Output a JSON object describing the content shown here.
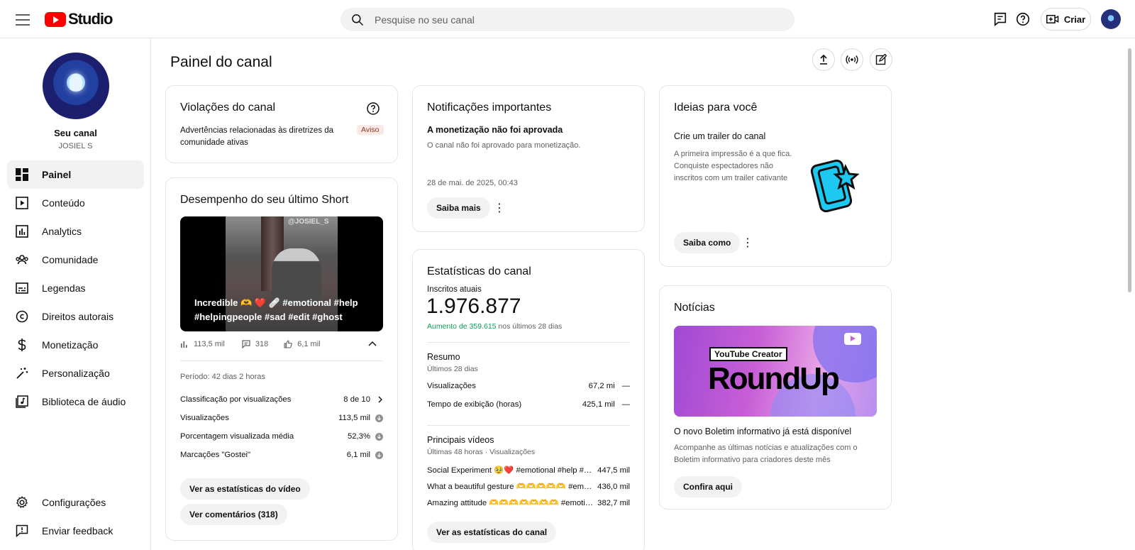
{
  "app": {
    "logo_text": "Studio"
  },
  "search": {
    "placeholder": "Pesquise no seu canal"
  },
  "topbar": {
    "create_label": "Criar"
  },
  "sidebar": {
    "channel_name": "Seu canal",
    "channel_handle": "JOSIEL S",
    "items": [
      {
        "label": "Painel",
        "icon": "dashboard-icon",
        "active": true
      },
      {
        "label": "Conteúdo",
        "icon": "content-icon"
      },
      {
        "label": "Analytics",
        "icon": "analytics-icon"
      },
      {
        "label": "Comunidade",
        "icon": "community-icon"
      },
      {
        "label": "Legendas",
        "icon": "subtitles-icon"
      },
      {
        "label": "Direitos autorais",
        "icon": "copyright-icon"
      },
      {
        "label": "Monetização",
        "icon": "monetization-icon"
      },
      {
        "label": "Personalização",
        "icon": "customization-icon"
      },
      {
        "label": "Biblioteca de áudio",
        "icon": "audio-library-icon"
      }
    ],
    "bottom_items": [
      {
        "label": "Configurações",
        "icon": "settings-icon"
      },
      {
        "label": "Enviar feedback",
        "icon": "feedback-icon"
      }
    ]
  },
  "page": {
    "title": "Painel do canal"
  },
  "violations": {
    "title": "Violações do canal",
    "text": "Advertências relacionadas às diretrizes da comunidade ativas",
    "badge": "Aviso"
  },
  "short": {
    "title": "Desempenho do seu último Short",
    "caption": "Incredible 🫶 ❤️ 🩹 #emotional #help #helpingpeople #sad #edit #ghost",
    "watermark": "@JOSIEL_S",
    "views": "113,5 mil",
    "comments": "318",
    "likes": "6,1 mil",
    "period": "Período: 42 dias 2 horas",
    "rows": [
      {
        "label": "Classificação por visualizações",
        "value": "8 de 10"
      },
      {
        "label": "Visualizações",
        "value": "113,5 mil"
      },
      {
        "label": "Porcentagem visualizada média",
        "value": "52,3%"
      },
      {
        "label": "Marcações \"Gostei\"",
        "value": "6,1 mil"
      }
    ],
    "btn_stats": "Ver as estatísticas do vídeo",
    "btn_comments": "Ver comentários (318)"
  },
  "notifications": {
    "title": "Notificações importantes",
    "subtitle": "A monetização não foi aprovada",
    "text": "O canal não foi aprovado para monetização.",
    "date": "28 de mai. de 2025, 00:43",
    "btn": "Saiba mais"
  },
  "stats": {
    "title": "Estatísticas do canal",
    "subs_label": "Inscritos atuais",
    "subs_value": "1.976.877",
    "growth_value": "Aumento de 359.615",
    "growth_suffix": "nos últimos 28 dias",
    "summary_title": "Resumo",
    "summary_sub": "Últimos 28 dias",
    "summary_rows": [
      {
        "label": "Visualizações",
        "value": "67,2 mi",
        "trend": "—"
      },
      {
        "label": "Tempo de exibição (horas)",
        "value": "425,1 mil",
        "trend": "—"
      }
    ],
    "top_title": "Principais vídeos",
    "top_sub": "Últimas 48 horas · Visualizações",
    "top_videos": [
      {
        "label": "Social Experiment 🥹❤️ #emotional #help #helpingpeople",
        "value": "447,5 mil"
      },
      {
        "label": "What a beautiful gesture 🫶🫶🫶🫶🫶 #emotional #help #helpingpeople",
        "value": "436,0 mil"
      },
      {
        "label": "Amazing attitude 🫶🫶🫶🫶🫶🫶🫶 #emotional #help #helpingpeople",
        "value": "382,7 mil"
      }
    ],
    "btn": "Ver as estatísticas do canal"
  },
  "ideas": {
    "title": "Ideias para você",
    "subtitle": "Crie um trailer do canal",
    "text": "A primeira impressão é a que fica. Conquiste espectadores não inscritos com um trailer cativante",
    "btn": "Saiba como"
  },
  "news": {
    "title": "Notícias",
    "img_label": "YouTube Creator",
    "img_big": "RoundUp",
    "subtitle": "O novo Boletim informativo já está disponível",
    "text": "Acompanhe as últimas notícias e atualizações com o Boletim informativo para criadores deste mês",
    "btn": "Confira aqui"
  },
  "colors": {
    "accent_red": "#ff0000",
    "growth_green": "#0f9d58",
    "badge_bg": "#fbe9e7"
  }
}
